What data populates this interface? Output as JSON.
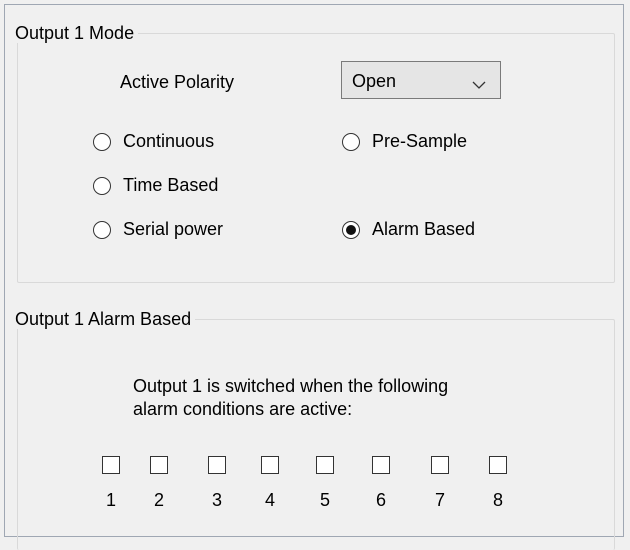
{
  "mode_group": {
    "title": "Output 1 Mode",
    "polarity_label": "Active Polarity",
    "polarity_value": "Open",
    "radios": [
      {
        "label": "Continuous",
        "selected": false
      },
      {
        "label": "Pre-Sample",
        "selected": false
      },
      {
        "label": "Time Based",
        "selected": false
      },
      {
        "label": "Serial power",
        "selected": false
      },
      {
        "label": "Alarm Based",
        "selected": true
      }
    ]
  },
  "alarm_group": {
    "title": "Output 1 Alarm Based",
    "description_line1": "Output 1 is switched when the following",
    "description_line2": "alarm conditions are active:",
    "checkboxes": [
      "1",
      "2",
      "3",
      "4",
      "5",
      "6",
      "7",
      "8"
    ]
  },
  "icons": {
    "dropdown": "chevron-down-icon"
  }
}
